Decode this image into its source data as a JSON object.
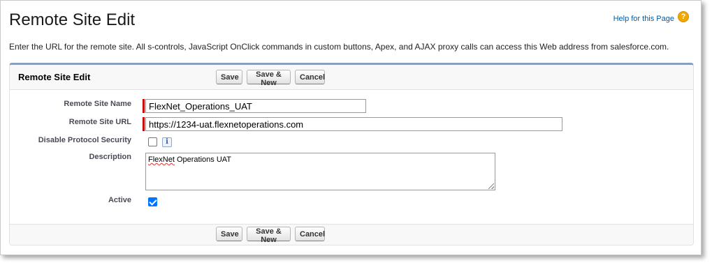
{
  "page": {
    "title": "Remote Site Edit",
    "help_link": "Help for this Page",
    "help_icon": "help-question-icon",
    "intro": "Enter the URL for the remote site. All s-controls, JavaScript OnClick commands in custom buttons, Apex, and AJAX proxy calls can access this Web address from salesforce.com."
  },
  "block": {
    "title": "Remote Site Edit",
    "buttons": {
      "save": "Save",
      "save_new": "Save & New",
      "cancel": "Cancel"
    }
  },
  "fields": {
    "remote_site_name": {
      "label": "Remote Site Name",
      "value": "FlexNet_Operations_UAT",
      "required": true
    },
    "remote_site_url": {
      "label": "Remote Site URL",
      "value": "https://1234-uat.flexnetoperations.com",
      "required": true
    },
    "disable_protocol_security": {
      "label": "Disable Protocol Security",
      "checked": false,
      "info_icon": "info-icon"
    },
    "description": {
      "label": "Description",
      "value_first_word": "FlexNet",
      "value_rest": " Operations UAT"
    },
    "active": {
      "label": "Active",
      "checked": true
    }
  },
  "colors": {
    "required": "#cc0000",
    "link": "#015ba7",
    "block_top_border": "#8a9ebe",
    "checkbox_checked": "#0075ff",
    "help_icon": "#f0a800"
  }
}
